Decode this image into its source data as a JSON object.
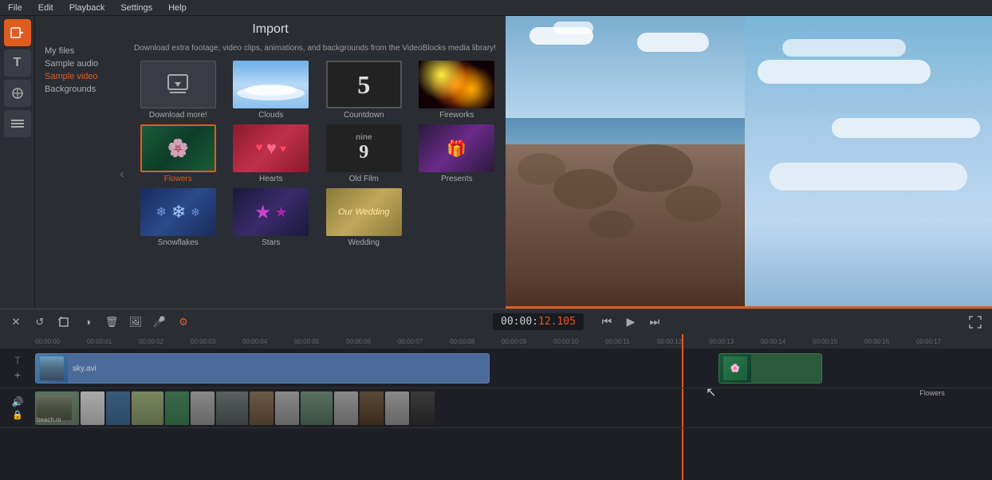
{
  "menu": {
    "items": [
      "File",
      "Edit",
      "Playback",
      "Settings",
      "Help"
    ]
  },
  "sidebar": {
    "icons": [
      {
        "name": "video-icon",
        "symbol": "▶",
        "active": true
      },
      {
        "name": "text-icon",
        "symbol": "T",
        "active": false
      },
      {
        "name": "effects-icon",
        "symbol": "✦",
        "active": false
      },
      {
        "name": "filter-icon",
        "symbol": "≡",
        "active": false
      }
    ]
  },
  "import": {
    "title": "Import",
    "description": "Download extra footage, video clips, animations, and backgrounds from the VideoBlocks media library!",
    "nav": [
      {
        "label": "My files",
        "active": false
      },
      {
        "label": "Sample audio",
        "active": false
      },
      {
        "label": "Sample video",
        "active": true
      },
      {
        "label": "Backgrounds",
        "active": false
      }
    ],
    "grid": [
      {
        "label": "Download more!",
        "type": "download",
        "highlighted": false
      },
      {
        "label": "Clouds",
        "type": "clouds",
        "highlighted": false
      },
      {
        "label": "Countdown",
        "type": "countdown",
        "highlighted": false
      },
      {
        "label": "Fireworks",
        "type": "fireworks",
        "highlighted": false
      },
      {
        "label": "Flowers",
        "type": "flowers",
        "highlighted": true
      },
      {
        "label": "Hearts",
        "type": "hearts",
        "highlighted": false
      },
      {
        "label": "Old Film",
        "type": "oldfilm",
        "highlighted": false
      },
      {
        "label": "Presents",
        "type": "presents",
        "highlighted": false
      },
      {
        "label": "Snowflakes",
        "type": "snowflakes",
        "highlighted": false
      },
      {
        "label": "Stars",
        "type": "stars",
        "highlighted": false
      },
      {
        "label": "Wedding",
        "type": "wedding",
        "highlighted": false
      }
    ]
  },
  "timeline": {
    "time_display": "00:00:",
    "time_red": "12.105",
    "ruler_marks": [
      "00:00:00",
      "00:00:01",
      "00:00:02",
      "00:00:03",
      "00:00:04",
      "00:00:05",
      "00:00:06",
      "00:00:07",
      "00:00:08",
      "00:00:09",
      "00:00:10",
      "00:00:11",
      "00:00:12",
      "00:00:13",
      "00:00:14",
      "00:00:15",
      "00:00:16",
      "00:00:17"
    ],
    "clips": [
      {
        "label": "sky.avi",
        "track": "video"
      },
      {
        "label": "Flowers",
        "track": "overlay"
      },
      {
        "label": "beach.m",
        "track": "audio"
      }
    ]
  },
  "toolbar": {
    "buttons": [
      "✕",
      "↺",
      "⬜",
      "◑",
      "🗑",
      "🖼",
      "🎤",
      "⚙"
    ]
  }
}
